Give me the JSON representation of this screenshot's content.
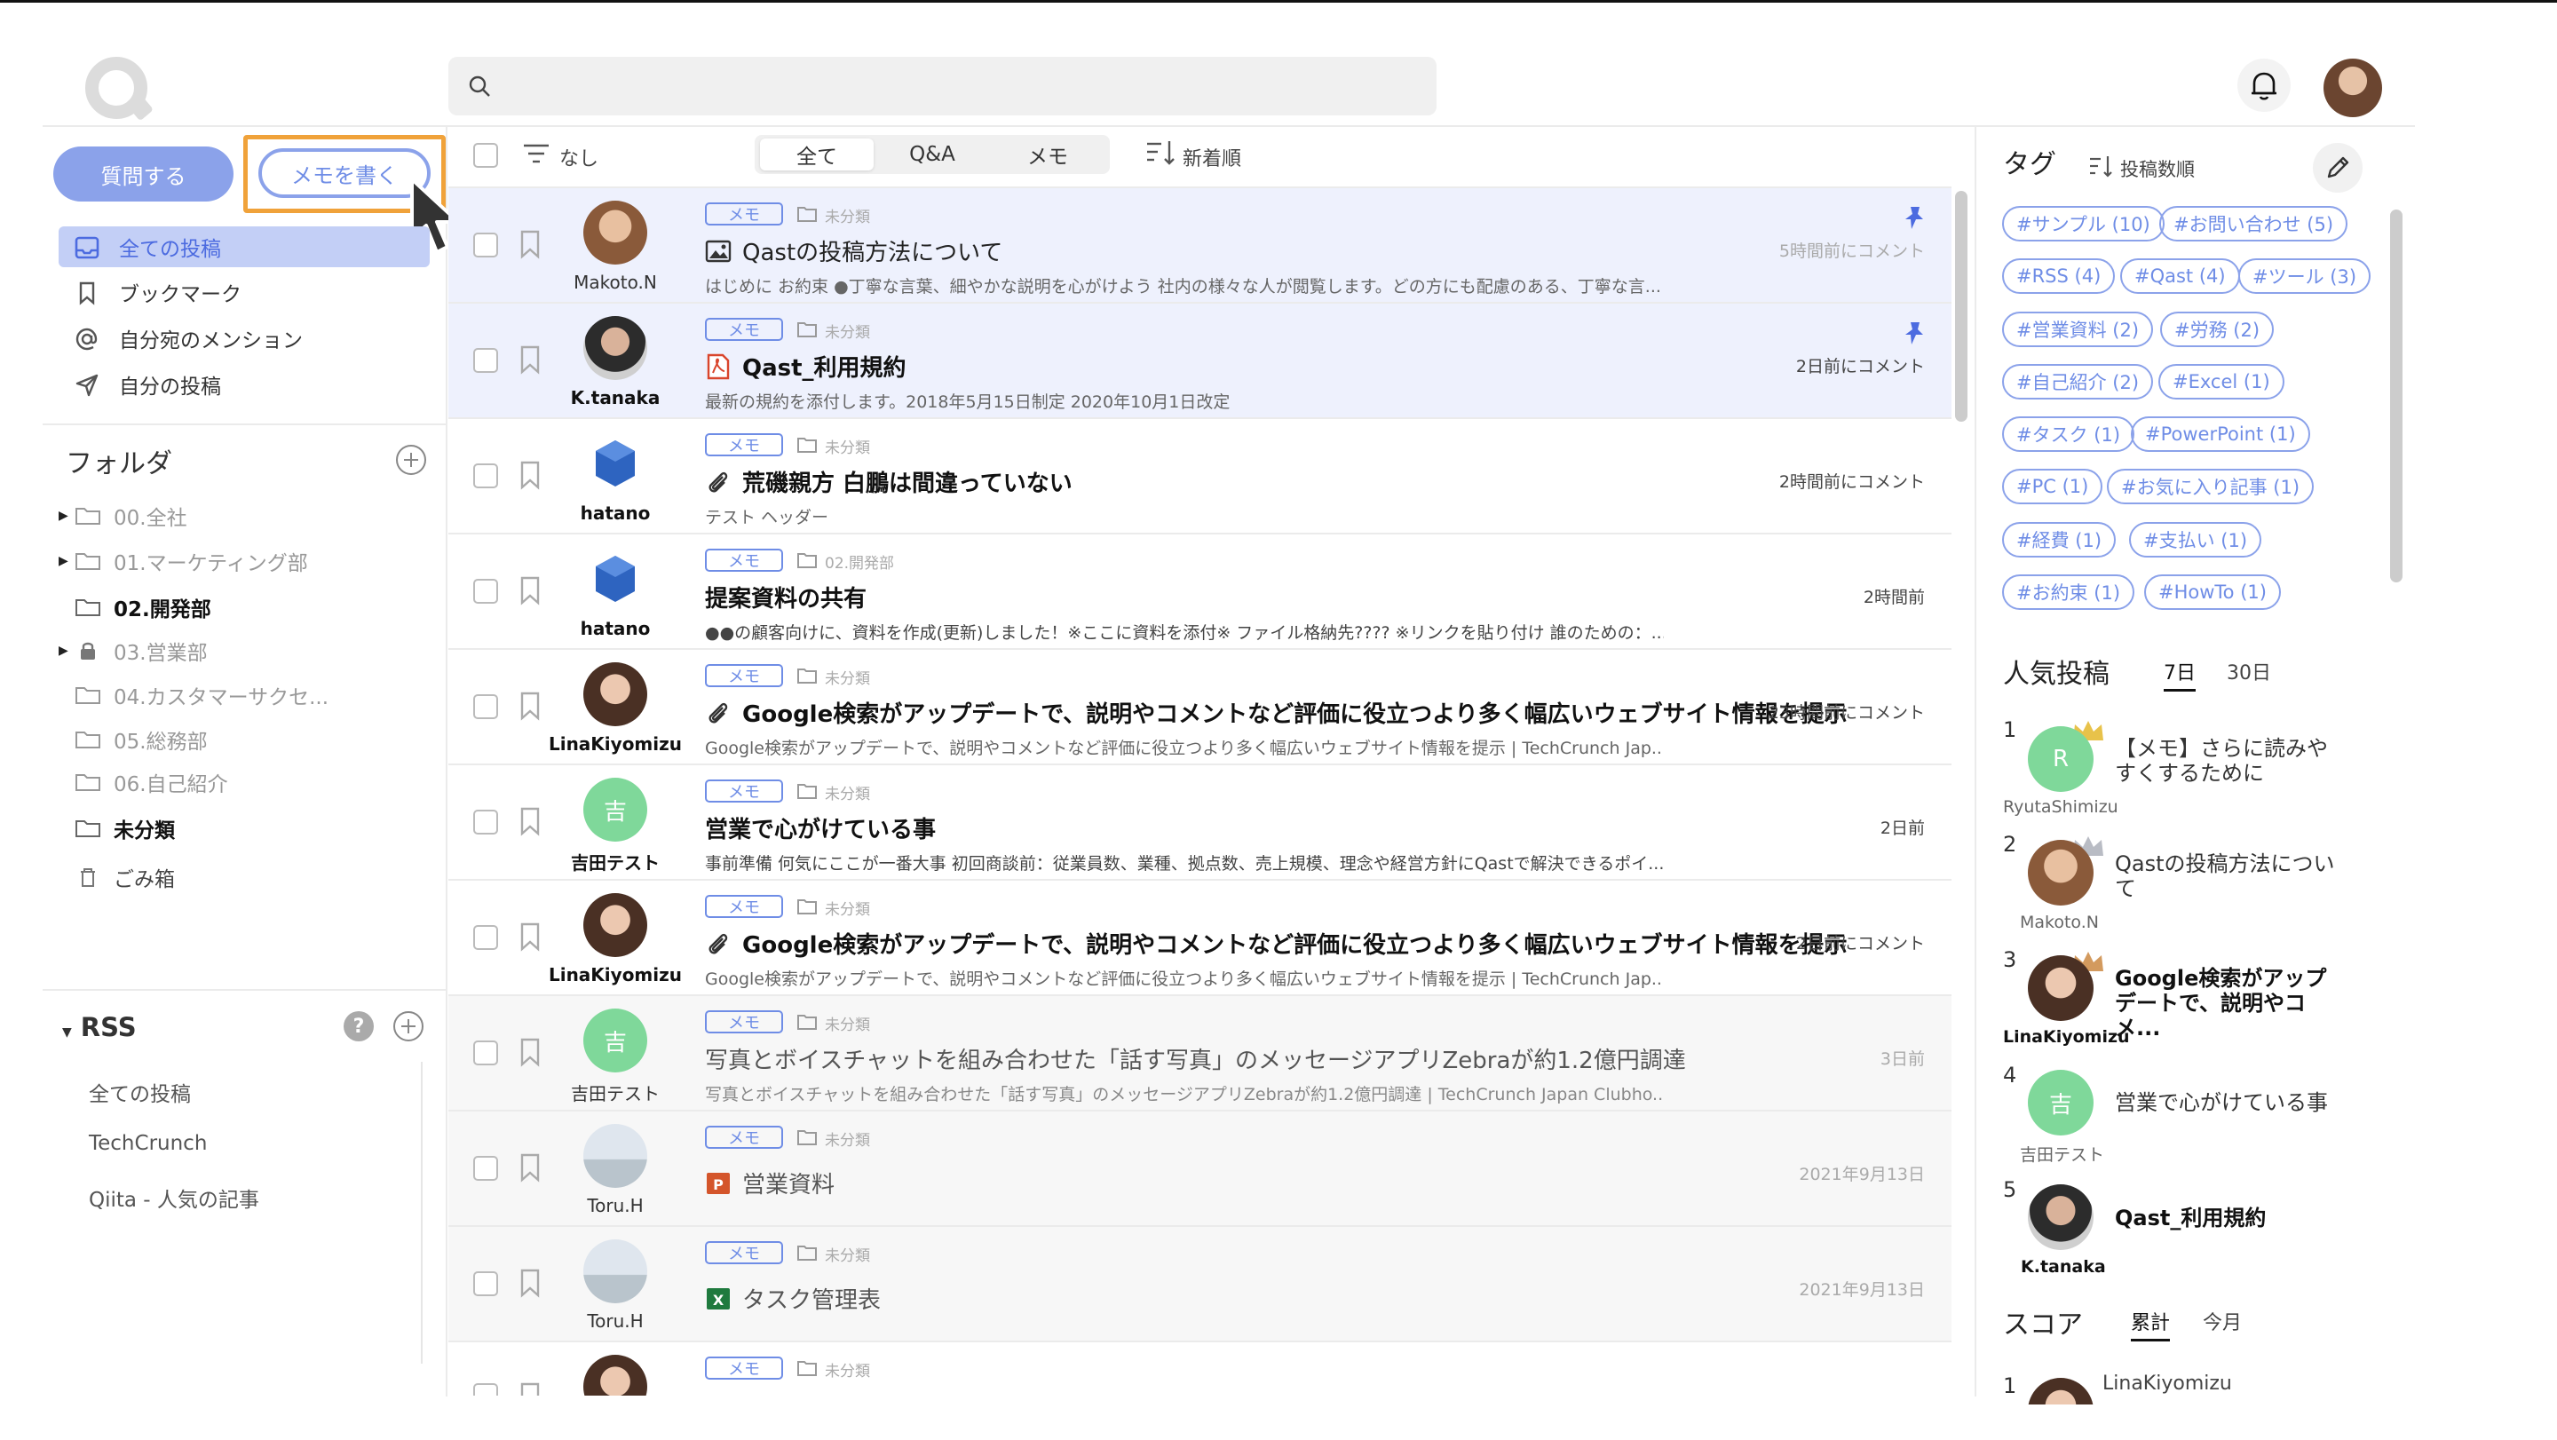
{
  "header": {
    "search_placeholder": ""
  },
  "sidebar": {
    "ask_button": "質問する",
    "memo_button": "メモを書く",
    "nav": [
      {
        "label": "全ての投稿",
        "active": true
      },
      {
        "label": "ブックマーク"
      },
      {
        "label": "自分宛のメンション"
      },
      {
        "label": "自分の投稿"
      }
    ],
    "folders_title": "フォルダ",
    "folders": [
      {
        "label": "00.全社",
        "expandable": true
      },
      {
        "label": "01.マーケティング部",
        "expandable": true
      },
      {
        "label": "02.開発部",
        "bold": true
      },
      {
        "label": "03.営業部",
        "expandable": true,
        "locked": true
      },
      {
        "label": "04.カスタマーサクセ..."
      },
      {
        "label": "05.総務部"
      },
      {
        "label": "06.自己紹介"
      },
      {
        "label": "未分類",
        "bold": true
      },
      {
        "label": "ごみ箱",
        "trash": true
      }
    ],
    "rss_title": "RSS",
    "rss_items": [
      "全ての投稿",
      "TechCrunch",
      "Qiita - 人気の記事"
    ]
  },
  "toolbar": {
    "filter_label": "なし",
    "tabs": [
      "全て",
      "Q&A",
      "メモ"
    ],
    "active_tab": "全て",
    "sort_label": "新着順"
  },
  "posts": [
    {
      "author": "Makoto.N",
      "tag": "メモ",
      "category": "未分類",
      "title": "Qastの投稿方法について",
      "title_icon": "image-icon",
      "excerpt": "はじめに お約束 ●丁寧な言葉、細やかな説明を心がけよう 社内の様々な人が閲覧します。どの方にも配慮のある、丁寧な言...",
      "time": "5時間前にコメント",
      "pinned": true,
      "read": false
    },
    {
      "author": "K.tanaka",
      "tag": "メモ",
      "category": "未分類",
      "title": "Qast_利用規約",
      "title_icon": "pdf-icon",
      "excerpt": "最新の規約を添付します。2018年5月15日制定 2020年10月1日改定",
      "time": "2日前にコメント",
      "pinned": true,
      "read": false
    },
    {
      "author": "hatano",
      "tag": "メモ",
      "category": "未分類",
      "title": "荒磯親方 白鵬は間違っていない",
      "title_icon": "paperclip-icon",
      "excerpt": "テスト ヘッダー",
      "time": "2時間前にコメント",
      "pinned": false,
      "read": false
    },
    {
      "author": "hatano",
      "tag": "メモ",
      "category": "02.開発部",
      "title": "提案資料の共有",
      "title_icon": "",
      "excerpt": "●●の顧客向けに、資料を作成(更新)しました！※ここに資料を添付※ ファイル格納先???? ※リンクを貼り付け 誰のための：...",
      "time": "2時間前",
      "pinned": false,
      "read": false
    },
    {
      "author": "LinaKiyomizu",
      "tag": "メモ",
      "category": "未分類",
      "title": "Google検索がアップデートで、説明やコメントなど評価に役立つより多く幅広いウェブサイト情報を提示",
      "title_icon": "paperclip-icon",
      "excerpt": "Google検索がアップデートで、説明やコメントなど評価に役立つより多く幅広いウェブサイト情報を提示 | TechCrunch Jap...",
      "time": "23時間前にコメント",
      "pinned": false,
      "read": false
    },
    {
      "author": "吉田テスト",
      "avatar_letter": "吉",
      "tag": "メモ",
      "category": "未分類",
      "title": "営業で心がけている事",
      "title_icon": "",
      "excerpt": "事前準備 何気にここが一番大事 初回商談前：従業員数、業種、拠点数、売上規模、理念や経営方針にQastで解決できるポイ...",
      "time": "2日前",
      "pinned": false,
      "read": false
    },
    {
      "author": "LinaKiyomizu",
      "tag": "メモ",
      "category": "未分類",
      "title": "Google検索がアップデートで、説明やコメントなど評価に役立つより多く幅広いウェブサイト情報を提示",
      "title_icon": "paperclip-icon",
      "excerpt": "Google検索がアップデートで、説明やコメントなど評価に役立つより多く幅広いウェブサイト情報を提示 | TechCrunch Jap...",
      "time": "2日前にコメント",
      "pinned": false,
      "read": false
    },
    {
      "author": "吉田テスト",
      "avatar_letter": "吉",
      "tag": "メモ",
      "category": "未分類",
      "title": "写真とボイスチャットを組み合わせた「話す写真」のメッセージアプリZebraが約1.2億円調達",
      "title_icon": "",
      "excerpt": "写真とボイスチャットを組み合わせた「話す写真」のメッセージアプリZebraが約1.2億円調達 | TechCrunch Japan Clubho...",
      "time": "3日前",
      "pinned": false,
      "read": true
    },
    {
      "author": "Toru.H",
      "tag": "メモ",
      "category": "未分類",
      "title": "営業資料",
      "title_icon": "ppt-icon",
      "excerpt": "",
      "time": "2021年9月13日",
      "pinned": false,
      "read": true
    },
    {
      "author": "Toru.H",
      "tag": "メモ",
      "category": "未分類",
      "title": "タスク管理表",
      "title_icon": "excel-icon",
      "excerpt": "",
      "time": "2021年9月13日",
      "pinned": false,
      "read": true
    },
    {
      "author": "",
      "tag": "メモ",
      "category": "未分類",
      "title": "",
      "title_icon": "",
      "excerpt": "",
      "time": "",
      "pinned": false,
      "read": false
    }
  ],
  "right_panel": {
    "tags_title": "タグ",
    "tags_sort": "投稿数順",
    "tags": [
      "#サンプル (10)",
      "#お問い合わせ (5)",
      "#RSS (4)",
      "#Qast (4)",
      "#ツール (3)",
      "#営業資料 (2)",
      "#労務 (2)",
      "#自己紹介 (2)",
      "#Excel (1)",
      "#タスク (1)",
      "#PowerPoint (1)",
      "#PC (1)",
      "#お気に入り記事 (1)",
      "#経費 (1)",
      "#支払い (1)",
      "#お約束 (1)",
      "#HowTo (1)"
    ],
    "popular_title": "人気投稿",
    "popular_tabs": [
      "7日",
      "30日"
    ],
    "popular_active": "7日",
    "popular": [
      {
        "rank": "1",
        "name": "RyutaShimizu",
        "avatar_letter": "R",
        "title": "【メモ】さらに読みやすくするために",
        "bold": false,
        "crown": "gold"
      },
      {
        "rank": "2",
        "name": "Makoto.N",
        "avatar_letter": "",
        "title": "Qastの投稿方法について",
        "bold": false,
        "crown": "silver"
      },
      {
        "rank": "3",
        "name": "LinaKiyomizu",
        "avatar_letter": "",
        "title": "Google検索がアップデートで、説明やコメ...",
        "bold": true,
        "crown": "bronze"
      },
      {
        "rank": "4",
        "name": "吉田テスト",
        "avatar_letter": "吉",
        "title": "営業で心がけている事",
        "bold": false,
        "crown": ""
      },
      {
        "rank": "5",
        "name": "K.tanaka",
        "avatar_letter": "",
        "title": "Qast_利用規約",
        "bold": true,
        "crown": ""
      }
    ],
    "score_title": "スコア",
    "score_tabs": [
      "累計",
      "今月"
    ],
    "score_active": "累計",
    "score": [
      {
        "rank": "1",
        "name": "LinaKiyomizu"
      }
    ]
  },
  "colors": {
    "accent": "#6f8de6",
    "accent_fill": "#8ba2ea",
    "highlight": "#f0a23a",
    "pinned_row": "#eef1fd"
  }
}
